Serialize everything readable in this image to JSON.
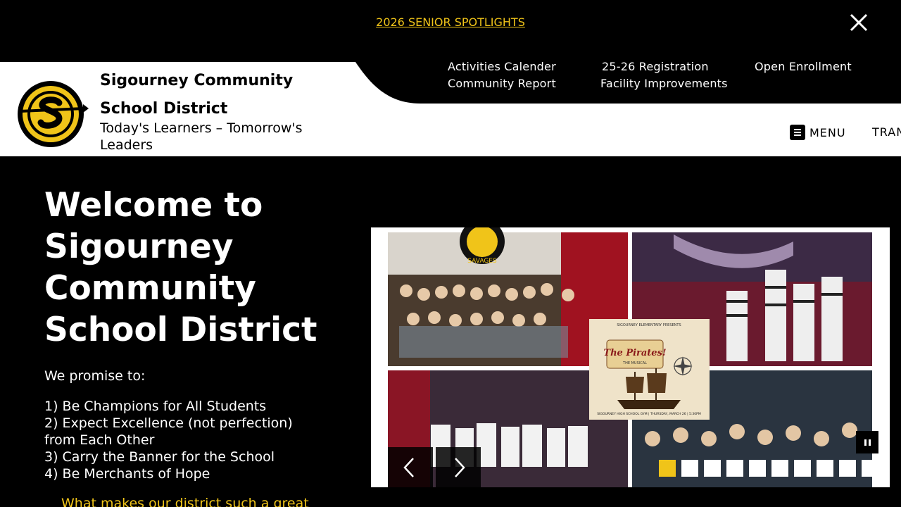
{
  "alert": {
    "link_text": "2026 SENIOR SPOTLIGHTS",
    "close_icon": "close-icon"
  },
  "header": {
    "logo_icon": "sigourney-savages-logo",
    "title": "Sigourney Community School District",
    "tagline": "Today's Learners – Tomorrow's Leaders",
    "quick_links": [
      "Activities Calender",
      "Community Report",
      "25-26 Registration",
      "Facility Improvements",
      "Open Enrollment"
    ],
    "menu_label": "MENU",
    "translate_label": "TRAN"
  },
  "hero": {
    "heading": "Welcome to Sigourney Community School District",
    "promise_title": "We promise to:",
    "promises": [
      "1) Be Champions for All Students",
      "2) Expect Excellence (not perfection) from Each Other",
      "3) Carry the Banner for the School",
      "4) Be Merchants of Hope"
    ],
    "more_link": "What makes our district such a great"
  },
  "slideshow": {
    "poster_small_text": "SIGOURNEY ELEMENTARY PRESENTS",
    "poster_title": "The Pirates!",
    "poster_subtitle": "THE MUSICAL",
    "poster_footer": "SIGOURNEY HIGH SCHOOL GYM | THURSDAY, MARCH 26 | 5:30PM",
    "banner_text": "SAVAGES",
    "slide_count": 10,
    "active_slide": 1,
    "prev_icon": "chevron-left-icon",
    "next_icon": "chevron-right-icon",
    "pause_icon": "pause-icon"
  },
  "colors": {
    "accent": "#f0c419",
    "background": "#000000"
  }
}
